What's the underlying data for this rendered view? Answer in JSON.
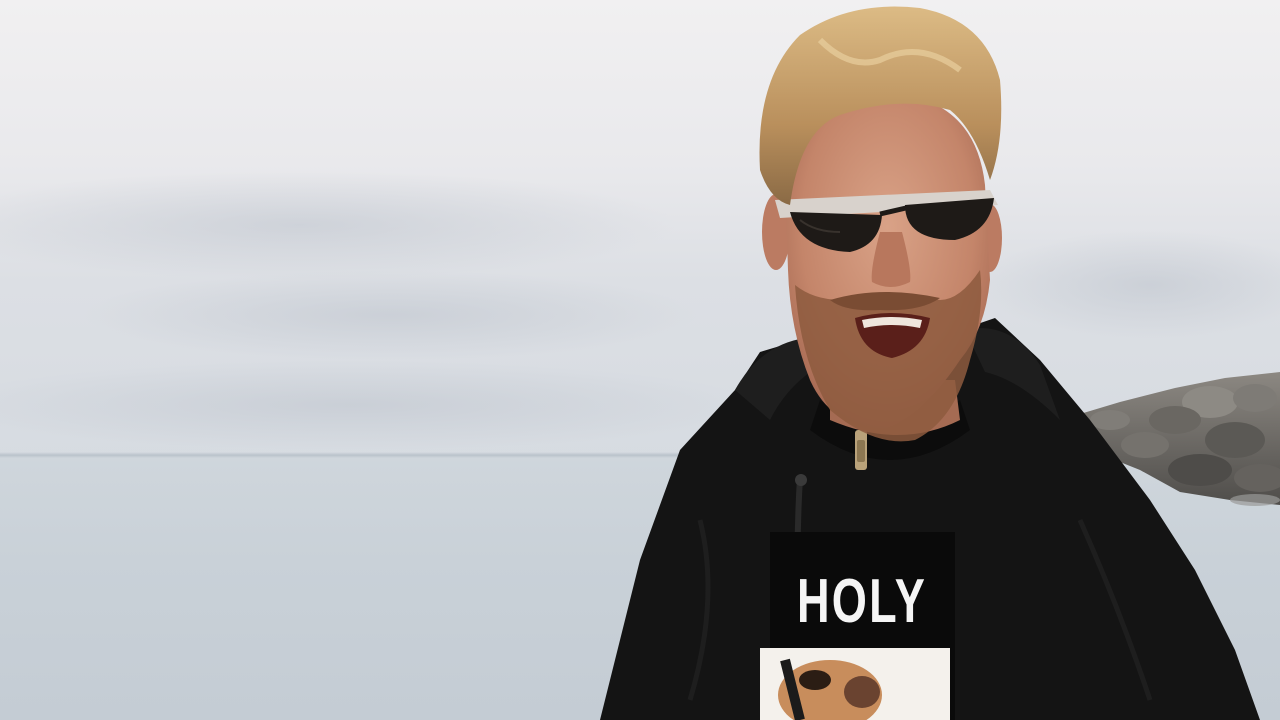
{
  "shirt": {
    "print_text": "HOLY"
  },
  "colors": {
    "sky": "#ecebee",
    "sea": "#c9d1d8",
    "hoodie": "#151515",
    "hair": "#c9a46d",
    "skin": "#c98f72",
    "sunglasses": "#1c1917",
    "rocks": "#6d6a66"
  }
}
